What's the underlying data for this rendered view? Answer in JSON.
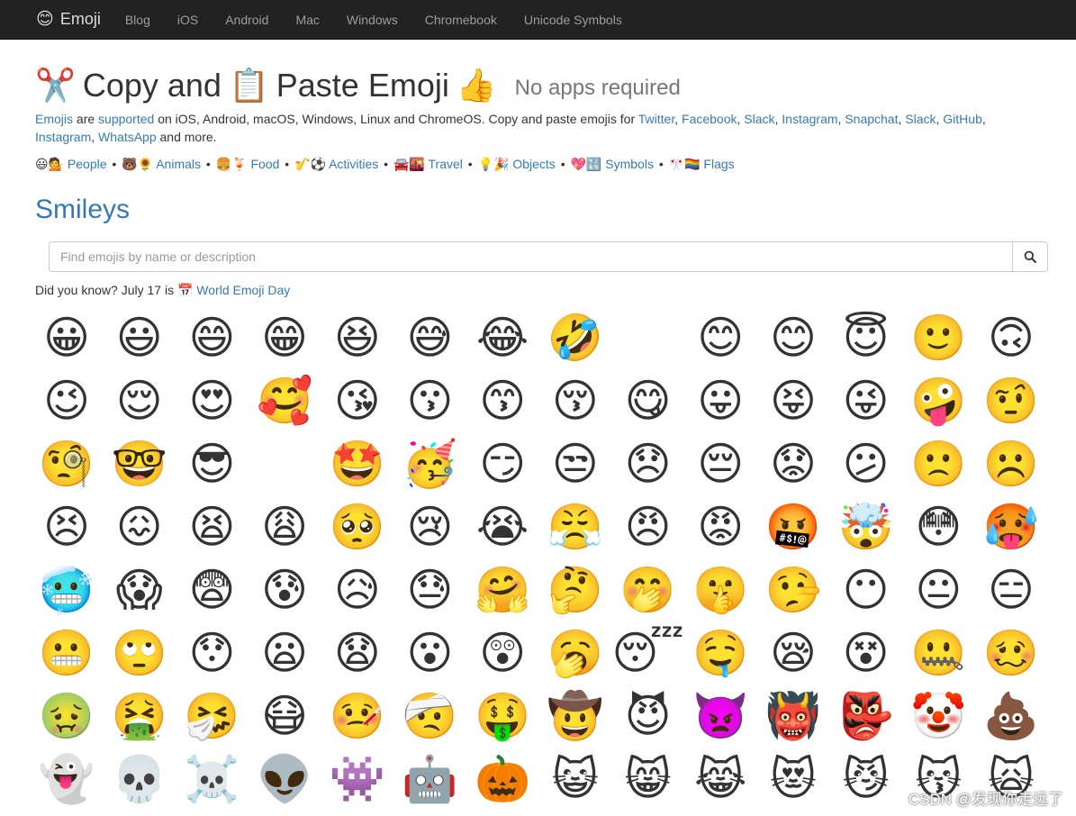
{
  "nav": {
    "brand_icon": "😊",
    "brand": "Emoji",
    "items": [
      "Blog",
      "iOS",
      "Android",
      "Mac",
      "Windows",
      "Chromebook",
      "Unicode Symbols"
    ]
  },
  "heading": {
    "emoji1": "✂️",
    "part1": "Copy and",
    "emoji2": "📋",
    "part2": "Paste Emoji",
    "emoji3": "👍",
    "subtitle": "No apps required"
  },
  "intro": {
    "emojis_link": "Emojis",
    "are": " are ",
    "supported_link": "supported",
    "text1": " on iOS, Android, macOS, Windows, Linux and ChromeOS. Copy and paste emojis for ",
    "links": [
      "Twitter",
      "Facebook",
      "Slack",
      "Instagram",
      "Snapchat",
      "Slack",
      "GitHub",
      "Instagram",
      "WhatsApp"
    ],
    "text2": " and more."
  },
  "categories": [
    {
      "emoji": "😃💁",
      "label": "People"
    },
    {
      "emoji": "🐻🌻",
      "label": "Animals"
    },
    {
      "emoji": "🍔🍹",
      "label": "Food"
    },
    {
      "emoji": "🎷⚽",
      "label": "Activities"
    },
    {
      "emoji": "🚘🌇",
      "label": "Travel"
    },
    {
      "emoji": "💡🎉",
      "label": "Objects"
    },
    {
      "emoji": "💖🔣",
      "label": "Symbols"
    },
    {
      "emoji": "🎌🏳️‍🌈",
      "label": "Flags"
    }
  ],
  "section_title": "Smileys",
  "search": {
    "placeholder": "Find emojis by name or description",
    "button_icon": "search-icon"
  },
  "didyouknow": {
    "text": "Did you know? July 17 is ",
    "icon": "📅",
    "link": "World Emoji Day"
  },
  "emojis": [
    "😀",
    "😃",
    "😄",
    "😁",
    "😆",
    "😅",
    "😂",
    "🤣",
    "",
    "😊",
    "😊",
    "😇",
    "🙂",
    "🙃",
    "😉",
    "😌",
    "😍",
    "🥰",
    "😘",
    "😗",
    "😙",
    "😚",
    "😋",
    "😛",
    "😝",
    "😜",
    "🤪",
    "🤨",
    "🧐",
    "🤓",
    "😎",
    "",
    "🤩",
    "🥳",
    "😏",
    "😒",
    "😞",
    "😔",
    "😟",
    "😕",
    "🙁",
    "☹️",
    "😣",
    "😖",
    "😫",
    "😩",
    "🥺",
    "😢",
    "😭",
    "😤",
    "😠",
    "😡",
    "🤬",
    "🤯",
    "😳",
    "🥵",
    "🥶",
    "😱",
    "😨",
    "😰",
    "😥",
    "😓",
    "🤗",
    "🤔",
    "🤭",
    "🤫",
    "🤥",
    "😶",
    "😐",
    "😑",
    "😬",
    "🙄",
    "😯",
    "😦",
    "😧",
    "😮",
    "😲",
    "🥱",
    "😴",
    "🤤",
    "😪",
    "😵",
    "🤐",
    "🥴",
    "🤢",
    "🤮",
    "🤧",
    "😷",
    "🤒",
    "🤕",
    "🤑",
    "🤠",
    "😈",
    "👿",
    "👹",
    "👺",
    "🤡",
    "💩",
    "👻",
    "💀",
    "☠️",
    "👽",
    "👾",
    "🤖",
    "🎃",
    "😺",
    "😸",
    "😹",
    "😻",
    "😼",
    "😽",
    "🙀"
  ],
  "watermark": "CSDN @发现你走远了"
}
